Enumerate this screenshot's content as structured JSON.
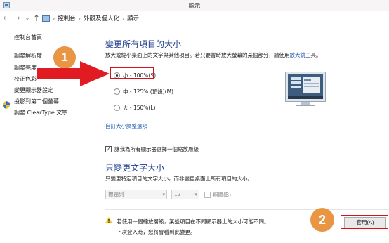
{
  "window": {
    "title": "顯示"
  },
  "address": {
    "crumbs": [
      "控制台",
      "外觀及個人化",
      "顯示"
    ]
  },
  "sidebar": {
    "home": "控制台首頁",
    "items": [
      "調整解析度",
      "調整亮度",
      "校正色彩",
      "變更顯示器設定",
      "投影到第二個螢幕",
      "調整 ClearType 文字"
    ]
  },
  "main": {
    "heading1": "變更所有項目的大小",
    "desc1_prefix": "放大或縮小桌面上的文字與其他項目。若只要暫時放大螢幕的某個部分，請使用",
    "desc1_link": "放大鏡",
    "desc1_suffix": "工具。",
    "options": [
      {
        "label": "小 - 100%(S)",
        "selected": true
      },
      {
        "label": "中 - 125% (預設)(M)",
        "selected": false
      },
      {
        "label": "大 - 150%(L)",
        "selected": false
      }
    ],
    "custom_link": "自訂大小調整選項",
    "checkbox_label": "讓我為所有顯示器選擇一個縮放層級",
    "checkbox_checked": true,
    "heading2": "只變更文字大小",
    "desc2": "只變更特定項目的文字大小，而非變更桌面上所有項目的大小。",
    "item_select": "標題列",
    "size_select": "12",
    "bold_label": "粗體(B)",
    "warning_line1": "若使用一個縮放層級，某些項目在不同顯示器上的大小可能不同。",
    "warning_line2": "下次登入時，您將會看到此變更。",
    "apply_label": "套用(A)"
  },
  "annotations": {
    "badge1": "1",
    "badge2": "2",
    "highlight_color": "#d8121b",
    "badge_color": "#e89544"
  }
}
